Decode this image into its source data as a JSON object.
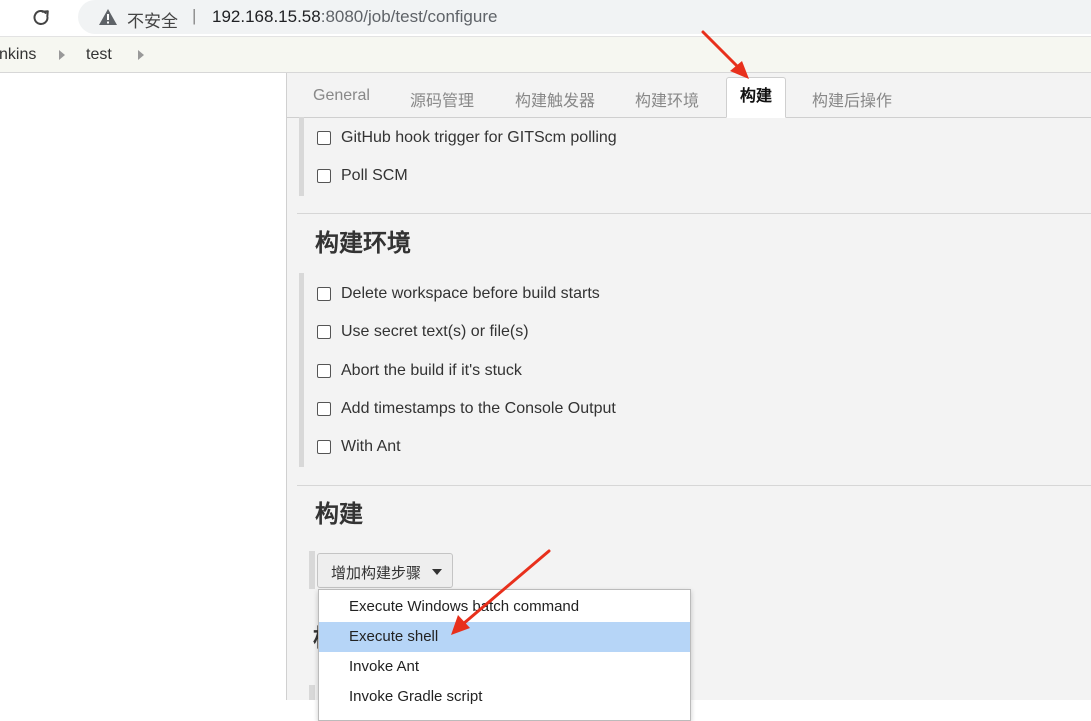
{
  "browser": {
    "security_label": "不安全",
    "separator": "|",
    "url_host": "192.168.15.58",
    "url_rest": ":8080/job/test/configure"
  },
  "breadcrumb": {
    "items": [
      "nkins",
      "test"
    ]
  },
  "tabs": [
    {
      "label": "General"
    },
    {
      "label": "源码管理"
    },
    {
      "label": "构建触发器"
    },
    {
      "label": "构建环境"
    },
    {
      "label": "构建"
    },
    {
      "label": "构建后操作"
    }
  ],
  "active_tab": "构建",
  "triggers": {
    "items": [
      {
        "label": "GitHub hook trigger for GITScm polling",
        "checked": false
      },
      {
        "label": "Poll SCM",
        "checked": false
      }
    ]
  },
  "build_env": {
    "title": "构建环境",
    "items": [
      {
        "label": "Delete workspace before build starts",
        "checked": false
      },
      {
        "label": "Use secret text(s) or file(s)",
        "checked": false
      },
      {
        "label": "Abort the build if it's stuck",
        "checked": false
      },
      {
        "label": "Add timestamps to the Console Output",
        "checked": false
      },
      {
        "label": "With Ant",
        "checked": false
      }
    ]
  },
  "build": {
    "title": "构建",
    "add_step_label": "增加构建步骤",
    "menu": [
      {
        "label": "Execute Windows batch command"
      },
      {
        "label": "Execute shell"
      },
      {
        "label": "Invoke Ant"
      },
      {
        "label": "Invoke Gradle script"
      }
    ],
    "highlighted_item": "Execute shell"
  },
  "colors": {
    "highlight": "#b6d5f7",
    "annotation_arrow": "#e8301c",
    "page_bg": "#f3f3f3"
  }
}
